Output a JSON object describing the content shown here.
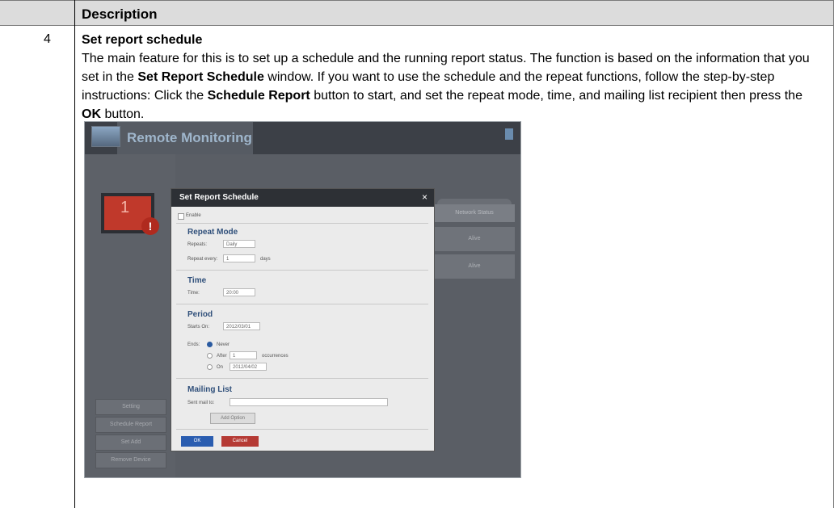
{
  "table": {
    "header": "Description",
    "step_number": "4",
    "step_title": "Set report schedule",
    "para": {
      "p1": "The main feature for this is to set up a schedule and the running report status. The function is based on the information that you set in the ",
      "b1": "Set Report Schedule",
      "p2": " window. If you want to use the schedule and the repeat functions, follow the step-by-step instructions: Click the ",
      "b2": "Schedule Report",
      "p3": " button to start, and set the repeat mode, time, and mailing list recipient then press the ",
      "b3": "OK",
      "p4": " button."
    }
  },
  "screenshot": {
    "app_title": "Remote Monitoring",
    "monitor_number": "1",
    "alert_symbol": "!",
    "side_buttons": [
      "Setting",
      "Schedule Report",
      "Set Add",
      "Remove Device"
    ],
    "right_column_header": "Network Status",
    "right_cells": [
      "Alive",
      "Alive"
    ],
    "dialog": {
      "title": "Set Report Schedule",
      "close": "×",
      "enable_label": "Enable",
      "repeat_mode": {
        "title": "Repeat Mode",
        "repeats_label": "Repeats:",
        "repeats_value": "Daily",
        "repeat_every_label": "Repeat every:",
        "repeat_every_value": "1",
        "repeat_every_unit": "days"
      },
      "time": {
        "title": "Time",
        "time_label": "Time:",
        "time_value": "20:00"
      },
      "period": {
        "title": "Period",
        "starts_on_label": "Starts On:",
        "starts_on_value": "2012/03/01",
        "ends_label": "Ends:",
        "never_label": "Never",
        "after_label": "After",
        "after_value": "1",
        "after_unit": "occurrences",
        "on_label": "On",
        "on_value": "2012/04/02"
      },
      "mailing": {
        "title": "Mailing List",
        "sent_mail_to_label": "Sent mail to:",
        "add_button": "Add Option"
      },
      "ok_button": "OK",
      "cancel_button": "Cancel"
    }
  }
}
